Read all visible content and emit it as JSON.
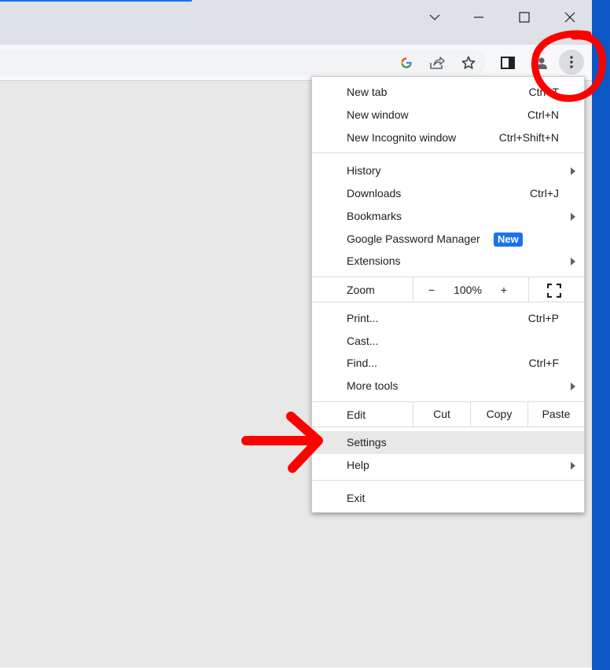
{
  "window": {
    "controls": {
      "tab_search_icon": "chevron-down-icon",
      "minimize_icon": "minimize-icon",
      "maximize_icon": "maximize-icon",
      "close_icon": "close-icon"
    }
  },
  "toolbar": {
    "icons": [
      "google-icon",
      "share-icon",
      "star-icon",
      "side-panel-icon",
      "profile-icon",
      "more-options-icon"
    ]
  },
  "menu": {
    "new_tab": {
      "label": "New tab",
      "shortcut": "Ctrl+T"
    },
    "new_window": {
      "label": "New window",
      "shortcut": "Ctrl+N"
    },
    "new_incognito": {
      "label": "New Incognito window",
      "shortcut": "Ctrl+Shift+N"
    },
    "history": {
      "label": "History"
    },
    "downloads": {
      "label": "Downloads",
      "shortcut": "Ctrl+J"
    },
    "bookmarks": {
      "label": "Bookmarks"
    },
    "password_manager": {
      "label": "Google Password Manager",
      "badge": "New"
    },
    "extensions": {
      "label": "Extensions"
    },
    "zoom": {
      "label": "Zoom",
      "minus": "−",
      "value": "100%",
      "plus": "+"
    },
    "print": {
      "label": "Print...",
      "shortcut": "Ctrl+P"
    },
    "cast": {
      "label": "Cast..."
    },
    "find": {
      "label": "Find...",
      "shortcut": "Ctrl+F"
    },
    "more_tools": {
      "label": "More tools"
    },
    "edit": {
      "label": "Edit",
      "cut": "Cut",
      "copy": "Copy",
      "paste": "Paste"
    },
    "settings": {
      "label": "Settings"
    },
    "help": {
      "label": "Help"
    },
    "exit": {
      "label": "Exit"
    }
  },
  "colors": {
    "accent": "#1a73e8",
    "annotation": "#ff0000",
    "desktop": "#0a57c6"
  }
}
